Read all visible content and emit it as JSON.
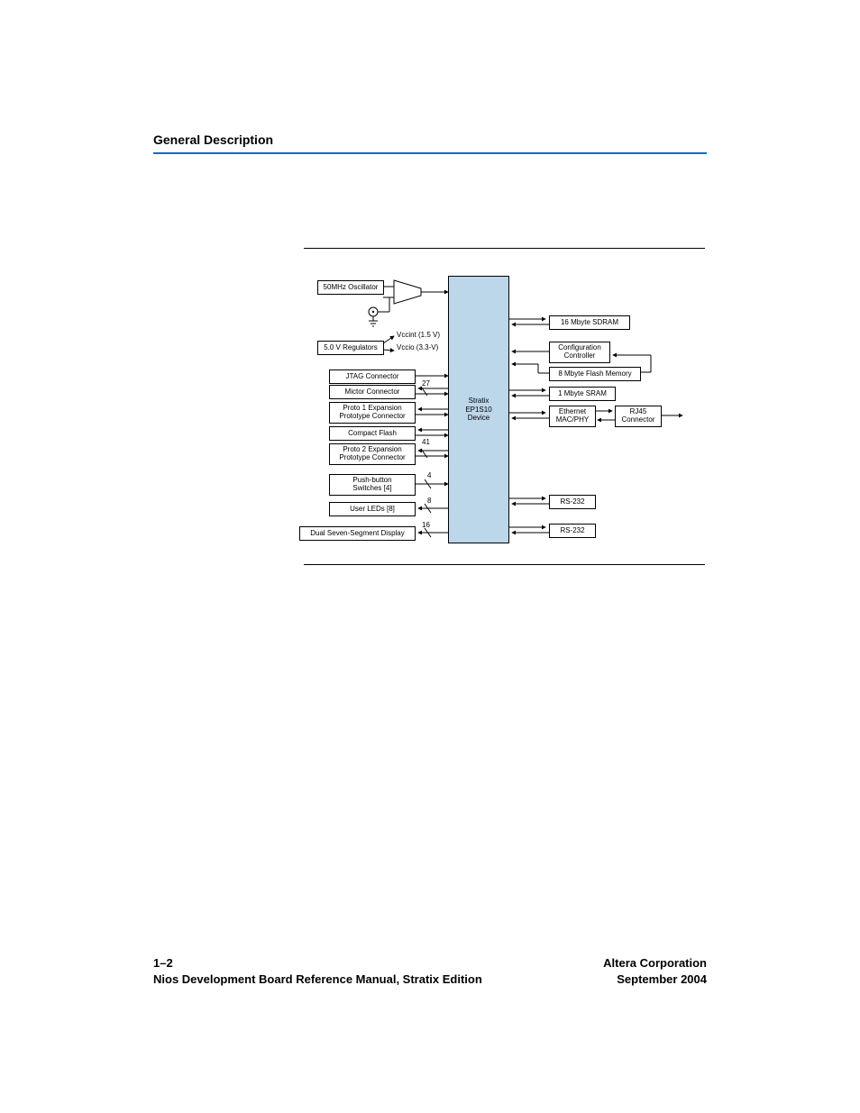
{
  "header": {
    "title": "General Description"
  },
  "footer": {
    "page": "1–2",
    "manual": "Nios Development Board Reference Manual, Stratix Edition",
    "company": "Altera Corporation",
    "date": "September 2004"
  },
  "diagram": {
    "center": {
      "line1": "Stratix",
      "line2": "EP1S10",
      "line3": "Device"
    },
    "left": {
      "osc": "50MHz Oscillator",
      "reg": "5.0 V Regulators",
      "vccint": "Vccint (1.5 V)",
      "vccio": "Vccio (3.3-V)",
      "jtag": "JTAG Connector",
      "mictor": "Mictor Connector",
      "proto1a": "Proto 1 Expansion",
      "proto1b": "Prototype Connector",
      "cflash": "Compact Flash",
      "proto2a": "Proto 2 Expansion",
      "proto2b": "Prototype Connector",
      "pba": "Push-button",
      "pbb": "Switches [4]",
      "leds": "User LEDs [8]",
      "sseg": "Dual Seven-Segment Display",
      "num27": "27",
      "num41": "41",
      "num4": "4",
      "num8": "8",
      "num16": "16"
    },
    "right": {
      "sdram": "16 Mbyte SDRAM",
      "cfga": "Configuration",
      "cfgb": "Controller",
      "flash": "8 Mbyte Flash Memory",
      "sram": "1 Mbyte SRAM",
      "etha": "Ethernet",
      "ethb": "MAC/PHY",
      "rj45a": "RJ45",
      "rj45b": "Connector",
      "rs232a": "RS-232",
      "rs232b": "RS-232"
    }
  }
}
